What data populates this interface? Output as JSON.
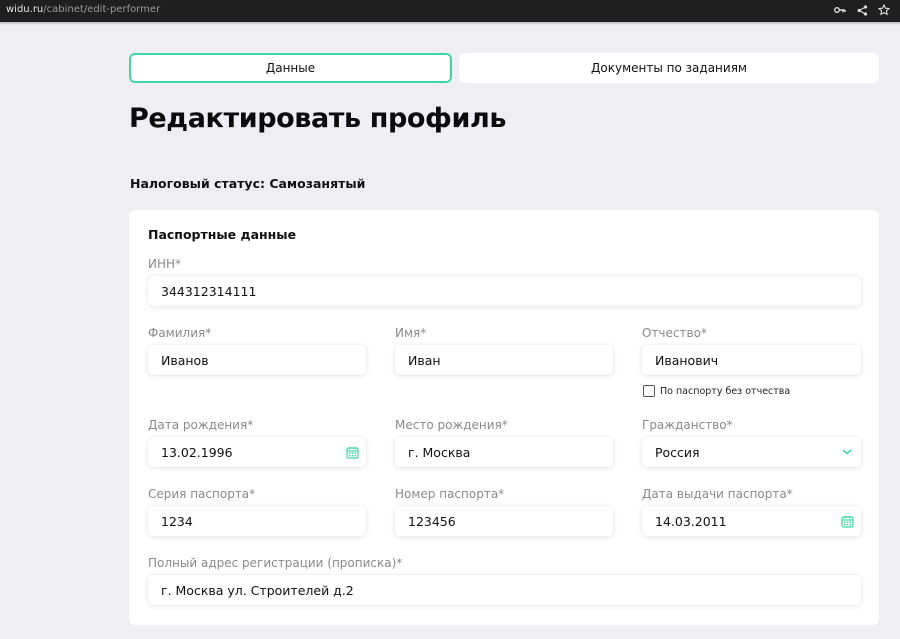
{
  "browser": {
    "url_host": "widu.ru",
    "url_path": "/cabinet/edit-performer"
  },
  "tabs": [
    {
      "label": "Данные",
      "active": true
    },
    {
      "label": "Документы по заданиям",
      "active": false
    }
  ],
  "page_title": "Редактировать профиль",
  "tax_status": "Налоговый статус: Самозанятый",
  "passport": {
    "title": "Паспортные данные",
    "inn": {
      "label": "ИНН*",
      "value": "344312314111"
    },
    "last_name": {
      "label": "Фамилия*",
      "value": "Иванов"
    },
    "first_name": {
      "label": "Имя*",
      "value": "Иван"
    },
    "patronymic": {
      "label": "Отчество*",
      "value": "Иванович"
    },
    "no_patronymic": {
      "label": "По паспорту без отчества",
      "checked": false
    },
    "birth_date": {
      "label": "Дата рождения*",
      "value": "13.02.1996"
    },
    "birth_place": {
      "label": "Место рождения*",
      "value": "г. Москва"
    },
    "citizenship": {
      "label": "Гражданство*",
      "value": "Россия"
    },
    "passport_series": {
      "label": "Серия паспорта*",
      "value": "1234"
    },
    "passport_number": {
      "label": "Номер паспорта*",
      "value": "123456"
    },
    "issue_date": {
      "label": "Дата выдачи паспорта*",
      "value": "14.03.2011"
    },
    "address": {
      "label": "Полный адрес регистрации (прописка)*",
      "value": "г. Москва ул. Строителей д.2"
    }
  },
  "colors": {
    "accent": "#3fd6a4",
    "background": "#efeff3"
  }
}
